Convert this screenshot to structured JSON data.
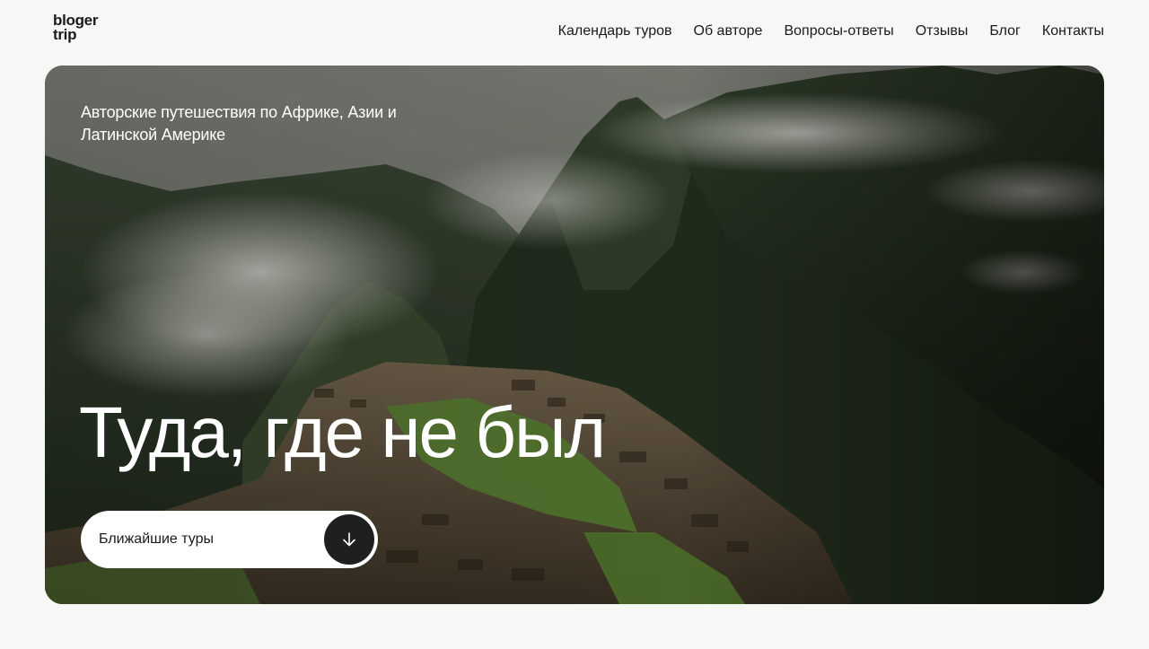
{
  "logo": {
    "line1": "bloger",
    "line2": "trip"
  },
  "nav": {
    "items": [
      {
        "label": "Календарь туров"
      },
      {
        "label": "Об авторе"
      },
      {
        "label": "Вопросы-ответы"
      },
      {
        "label": "Отзывы"
      },
      {
        "label": "Блог"
      },
      {
        "label": "Контакты"
      }
    ]
  },
  "hero": {
    "subtitle": "Авторские путешествия по Африке, Азии и Латинской Америке",
    "title": "Туда, где не был",
    "cta_label": "Ближайшие туры",
    "cta_icon": "arrow-down-icon"
  },
  "colors": {
    "page_bg": "#f7f7f5",
    "text_dark": "#1a1a1a",
    "cta_bg": "#ffffff",
    "cta_arrow_bg": "#1f1f1f"
  }
}
